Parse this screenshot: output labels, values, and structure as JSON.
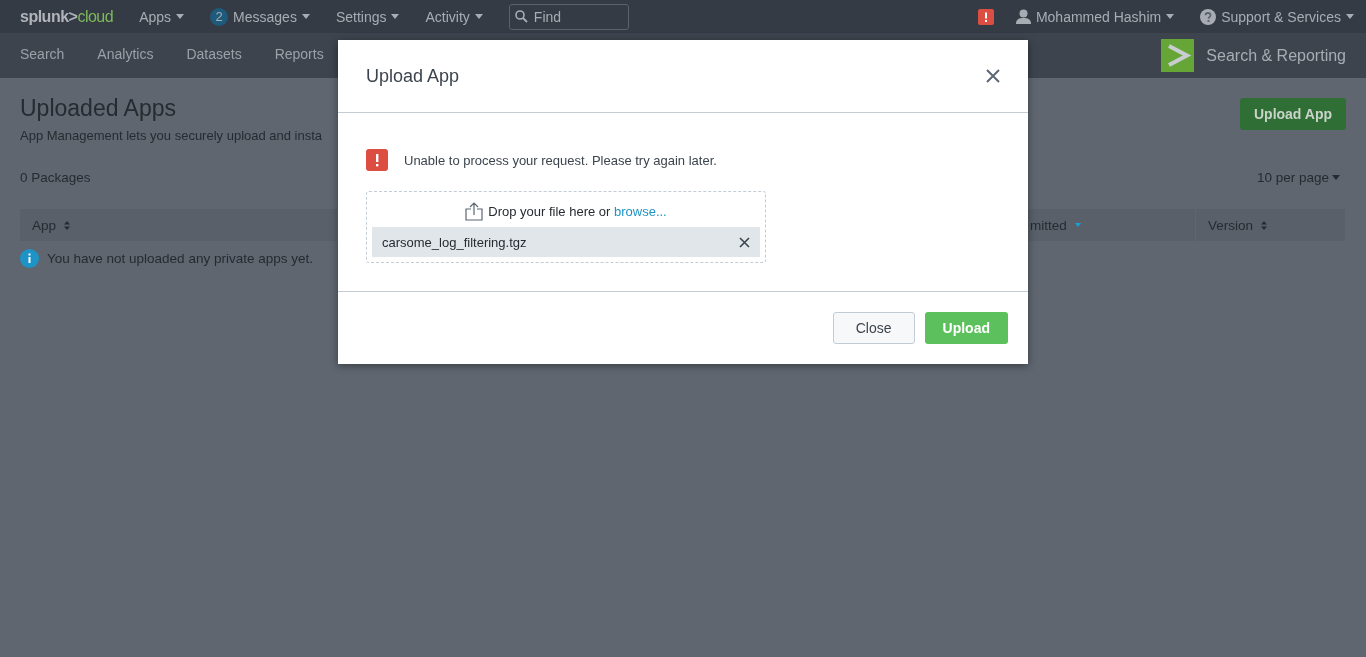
{
  "top_bar": {
    "logo": {
      "brand": "splunk>",
      "product": "cloud"
    },
    "menus": [
      {
        "label": "Apps"
      },
      {
        "label": "Messages",
        "badge": "2"
      },
      {
        "label": "Settings"
      },
      {
        "label": "Activity"
      }
    ],
    "search": {
      "placeholder": "Find"
    },
    "user": {
      "label": "Mohammed Hashim"
    },
    "support": {
      "label": "Support & Services"
    }
  },
  "app_bar": {
    "tabs": [
      {
        "label": "Search",
        "selected": false
      },
      {
        "label": "Analytics",
        "selected": false
      },
      {
        "label": "Datasets",
        "selected": false
      },
      {
        "label": "Reports",
        "selected": false
      }
    ],
    "app_name": "Search & Reporting"
  },
  "page": {
    "title": "Uploaded Apps",
    "description": "App Management lets you securely upload and insta",
    "upload_button": "Upload App",
    "count": "0 Packages",
    "per_page": "10 per page",
    "table": {
      "columns": [
        {
          "label": "App",
          "kind": "sortable"
        },
        {
          "label": "mitted",
          "kind": "sorted"
        },
        {
          "label": "Version",
          "kind": "sortable"
        }
      ]
    },
    "empty_message": "You have not uploaded any private apps yet."
  },
  "dialog": {
    "title": "Upload App",
    "error": "Unable to process your request. Please try again later.",
    "dropzone": {
      "text": "Drop your file here or ",
      "link": "browse..."
    },
    "file": {
      "name": "carsome_log_filtering.tgz"
    },
    "buttons": [
      {
        "label": "Close",
        "kind": "secondary"
      },
      {
        "label": "Upload",
        "kind": "primary"
      }
    ]
  }
}
